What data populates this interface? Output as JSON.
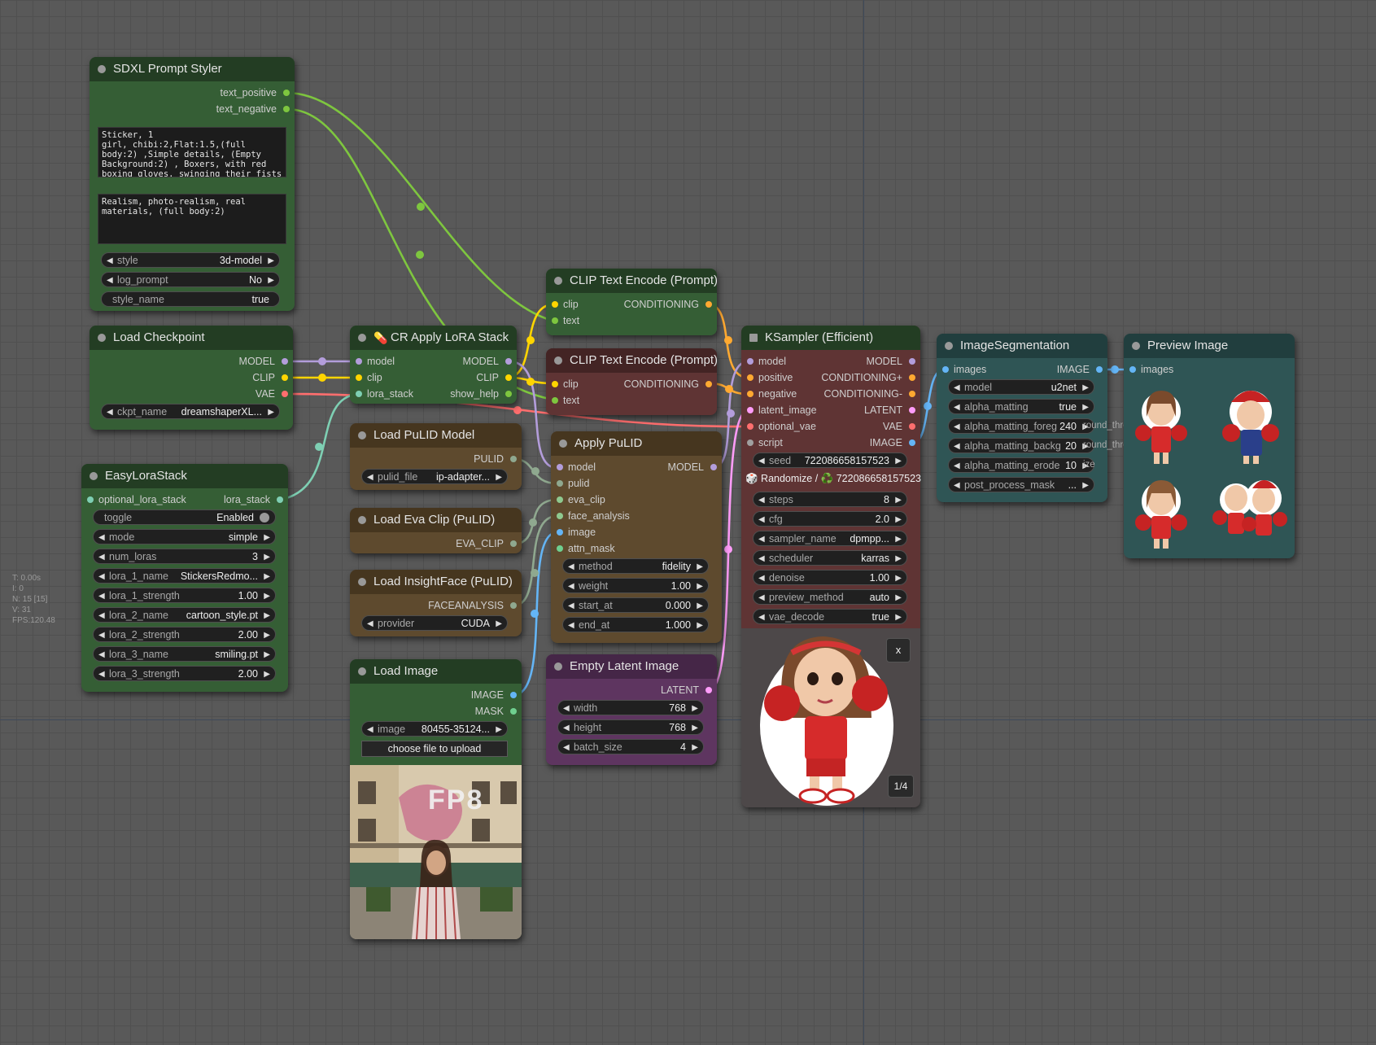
{
  "colors": {
    "model": "#b39ddb",
    "clip": "#ffd500",
    "vae": "#ff6e6e",
    "conditioning": "#ffa931",
    "latent": "#ff9cf9",
    "image": "#64b5f6",
    "string": "#7ec63f",
    "lora_stack": "#7ecfb3",
    "pulid": "#8fa88f",
    "script": "#a0a0a0"
  },
  "stats": {
    "t": "T: 0.00s",
    "i": "I: 0",
    "n": "N: 15 [15]",
    "v": "V: 31",
    "fps": "FPS:120.48"
  },
  "nodes": {
    "sdxl_styler": {
      "title": "SDXL Prompt Styler",
      "out_pos": "text_positive",
      "out_neg": "text_negative",
      "text_positive": "Sticker, 1\ngirl, chibi:2,Flat:1.5,(full\nbody:2) ,Simple details, (Empty\nBackground:2) , Boxers, with red\nboxing gloves, swinging their fists",
      "text_negative": "Realism, photo-realism, real\nmaterials, (full body:2)",
      "style_label": "style",
      "style_value": "3d-model",
      "log_label": "log_prompt",
      "log_value": "No",
      "style_name_label": "style_name",
      "style_name_value": "true"
    },
    "load_checkpoint": {
      "title": "Load Checkpoint",
      "out_model": "MODEL",
      "out_clip": "CLIP",
      "out_vae": "VAE",
      "ckpt_label": "ckpt_name",
      "ckpt_value": "dreamshaperXL..."
    },
    "easy_lora": {
      "title": "EasyLoraStack",
      "in": "optional_lora_stack",
      "out": "lora_stack",
      "widgets": [
        {
          "label": "toggle",
          "value": "Enabled"
        },
        {
          "label": "mode",
          "value": "simple"
        },
        {
          "label": "num_loras",
          "value": "3"
        },
        {
          "label": "lora_1_name",
          "value": "StickersRedmo..."
        },
        {
          "label": "lora_1_strength",
          "value": "1.00"
        },
        {
          "label": "lora_2_name",
          "value": "cartoon_style.pt"
        },
        {
          "label": "lora_2_strength",
          "value": "2.00"
        },
        {
          "label": "lora_3_name",
          "value": "smiling.pt"
        },
        {
          "label": "lora_3_strength",
          "value": "2.00"
        }
      ]
    },
    "cr_lora": {
      "title": "CR Apply LoRA Stack",
      "icon": "💊",
      "in_model": "model",
      "in_clip": "clip",
      "in_lora": "lora_stack",
      "out_model": "MODEL",
      "out_clip": "CLIP",
      "out_help": "show_help"
    },
    "pulid_model": {
      "title": "Load PuLID Model",
      "out": "PULID",
      "file_label": "pulid_file",
      "file_value": "ip-adapter..."
    },
    "eva_clip": {
      "title": "Load Eva Clip (PuLID)",
      "out": "EVA_CLIP"
    },
    "insightface": {
      "title": "Load InsightFace (PuLID)",
      "out": "FACEANALYSIS",
      "provider_label": "provider",
      "provider_value": "CUDA"
    },
    "load_image": {
      "title": "Load Image",
      "out_image": "IMAGE",
      "out_mask": "MASK",
      "image_label": "image",
      "image_value": "80455-35124...",
      "upload_label": "choose file to upload",
      "overlay_text": "FP8"
    },
    "clip_pos": {
      "title": "CLIP Text Encode (Prompt)",
      "in_clip": "clip",
      "in_text": "text",
      "out": "CONDITIONING"
    },
    "clip_neg": {
      "title": "CLIP Text Encode (Prompt)",
      "in_clip": "clip",
      "in_text": "text",
      "out": "CONDITIONING"
    },
    "apply_pulid": {
      "title": "Apply PuLID",
      "in_model": "model",
      "in_pulid": "pulid",
      "in_eva": "eva_clip",
      "in_face": "face_analysis",
      "in_image": "image",
      "in_mask": "attn_mask",
      "out": "MODEL",
      "widgets": [
        {
          "label": "method",
          "value": "fidelity"
        },
        {
          "label": "weight",
          "value": "1.00"
        },
        {
          "label": "start_at",
          "value": "0.000"
        },
        {
          "label": "end_at",
          "value": "1.000"
        }
      ]
    },
    "empty_latent": {
      "title": "Empty Latent Image",
      "out": "LATENT",
      "widgets": [
        {
          "label": "width",
          "value": "768"
        },
        {
          "label": "height",
          "value": "768"
        },
        {
          "label": "batch_size",
          "value": "4"
        }
      ]
    },
    "ksampler": {
      "title": "KSampler (Efficient)",
      "inputs": [
        "model",
        "positive",
        "negative",
        "latent_image",
        "optional_vae",
        "script"
      ],
      "outputs": [
        "MODEL",
        "CONDITIONING+",
        "CONDITIONING-",
        "LATENT",
        "VAE",
        "IMAGE"
      ],
      "seed_label": "seed",
      "seed_value": "722086658157523",
      "randomize": "🎲 Randomize / ♻️ 722086658157523",
      "widgets": [
        {
          "label": "steps",
          "value": "8"
        },
        {
          "label": "cfg",
          "value": "2.0"
        },
        {
          "label": "sampler_name",
          "value": "dpmpp..."
        },
        {
          "label": "scheduler",
          "value": "karras"
        },
        {
          "label": "denoise",
          "value": "1.00"
        },
        {
          "label": "preview_method",
          "value": "auto"
        },
        {
          "label": "vae_decode",
          "value": "true"
        }
      ],
      "close": "x",
      "page": "1/4"
    },
    "image_seg": {
      "title": "ImageSegmentation",
      "in": "images",
      "out": "IMAGE",
      "widgets": [
        {
          "label": "model",
          "value": "u2net",
          "overflow": ""
        },
        {
          "label": "alpha_matting",
          "value": "true",
          "overflow": ""
        },
        {
          "label": "alpha_matting_foreg",
          "value": "240",
          "overflow": "round_threshold"
        },
        {
          "label": "alpha_matting_backg",
          "value": "20",
          "overflow": "round_threshold"
        },
        {
          "label": "alpha_matting_erode",
          "value": "10",
          "overflow": "ize"
        },
        {
          "label": "post_process_mask",
          "value": "...",
          "overflow": ""
        }
      ]
    },
    "preview": {
      "title": "Preview Image",
      "in": "images"
    }
  }
}
